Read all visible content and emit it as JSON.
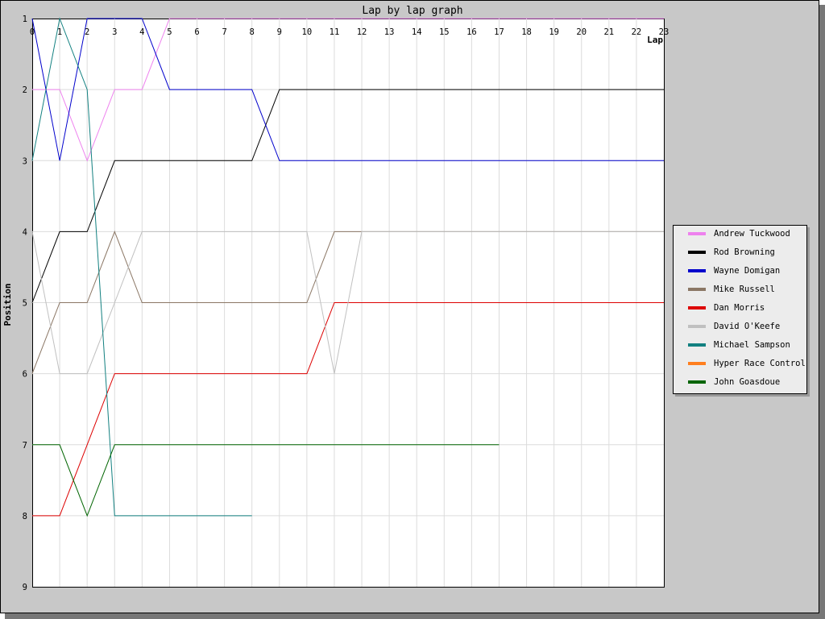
{
  "chart_data": {
    "type": "line",
    "title": "Lap by lap graph",
    "xlabel": "Lap",
    "ylabel": "Position",
    "xlim": [
      0,
      23
    ],
    "ylim": [
      1,
      9
    ],
    "y_inverted": true,
    "grid": true,
    "legend_position": "right",
    "x_ticks": [
      "0",
      "1",
      "2",
      "3",
      "4",
      "5",
      "6",
      "7",
      "8",
      "9",
      "10",
      "11",
      "12",
      "13",
      "14",
      "15",
      "16",
      "17",
      "18",
      "19",
      "20",
      "21",
      "22",
      "23"
    ],
    "y_ticks": [
      "1",
      "2",
      "3",
      "4",
      "5",
      "6",
      "7",
      "8",
      "9"
    ],
    "series": [
      {
        "name": "Andrew Tuckwood",
        "color": "#ee82ee",
        "x": [
          0,
          1,
          2,
          3,
          4,
          5,
          6,
          7,
          8,
          9,
          10,
          11,
          12,
          13,
          14,
          15,
          16,
          17,
          18,
          19,
          20,
          21,
          22,
          23
        ],
        "y": [
          2,
          2,
          3,
          2,
          2,
          1,
          1,
          1,
          1,
          1,
          1,
          1,
          1,
          1,
          1,
          1,
          1,
          1,
          1,
          1,
          1,
          1,
          1,
          1
        ]
      },
      {
        "name": "Rod Browning",
        "color": "#000000",
        "x": [
          0,
          1,
          2,
          3,
          4,
          5,
          6,
          7,
          8,
          9,
          10,
          11,
          12,
          13,
          14,
          15,
          16,
          17,
          18,
          19,
          20,
          21,
          22,
          23
        ],
        "y": [
          5,
          4,
          4,
          3,
          3,
          3,
          3,
          3,
          3,
          2,
          2,
          2,
          2,
          2,
          2,
          2,
          2,
          2,
          2,
          2,
          2,
          2,
          2,
          2
        ]
      },
      {
        "name": "Wayne Domigan",
        "color": "#0000cc",
        "x": [
          0,
          1,
          2,
          3,
          4,
          5,
          6,
          7,
          8,
          9,
          10,
          11,
          12,
          13,
          14,
          15,
          16,
          17,
          18,
          19,
          20,
          21,
          22,
          23
        ],
        "y": [
          1,
          3,
          1,
          1,
          1,
          2,
          2,
          2,
          2,
          3,
          3,
          3,
          3,
          3,
          3,
          3,
          3,
          3,
          3,
          3,
          3,
          3,
          3,
          3
        ]
      },
      {
        "name": "Mike Russell",
        "color": "#8b7765",
        "x": [
          0,
          1,
          2,
          3,
          4,
          5,
          6,
          7,
          8,
          9,
          10,
          11,
          12,
          13,
          14,
          15,
          16,
          17,
          18,
          19,
          20,
          21,
          22,
          23
        ],
        "y": [
          6,
          5,
          5,
          4,
          5,
          5,
          5,
          5,
          5,
          5,
          5,
          4,
          4,
          4,
          4,
          4,
          4,
          4,
          4,
          4,
          4,
          4,
          4,
          4
        ]
      },
      {
        "name": "Dan Morris",
        "color": "#dd0000",
        "x": [
          0,
          1,
          2,
          3,
          4,
          5,
          6,
          7,
          8,
          9,
          10,
          11,
          12,
          13,
          14,
          15,
          16,
          17,
          18,
          19,
          20,
          21,
          22,
          23
        ],
        "y": [
          8,
          8,
          7,
          6,
          6,
          6,
          6,
          6,
          6,
          6,
          6,
          5,
          5,
          5,
          5,
          5,
          5,
          5,
          5,
          5,
          5,
          5,
          5,
          5
        ]
      },
      {
        "name": "David O'Keefe",
        "color": "#c0c0c0",
        "x": [
          0,
          1,
          2,
          3,
          4,
          5,
          6,
          7,
          8,
          9,
          10,
          11,
          12,
          13,
          14,
          15,
          16,
          17,
          18,
          19,
          20,
          21,
          22,
          23
        ],
        "y": [
          4,
          6,
          6,
          5,
          4,
          4,
          4,
          4,
          4,
          4,
          4,
          6,
          4,
          4,
          4,
          4,
          4,
          4,
          4,
          4,
          4,
          4,
          4,
          4
        ]
      },
      {
        "name": "Michael Sampson",
        "color": "#128080",
        "x": [
          0,
          1,
          2,
          3,
          4,
          5,
          6,
          7,
          8
        ],
        "y": [
          3,
          1,
          2,
          8,
          8,
          8,
          8,
          8,
          8
        ]
      },
      {
        "name": "Hyper Race Control",
        "color": "#ff7f1e",
        "x": [],
        "y": []
      },
      {
        "name": "John Goasdoue",
        "color": "#006400",
        "x": [
          0,
          1,
          2,
          3,
          4,
          5,
          6,
          7,
          8,
          9,
          10,
          11,
          12,
          13,
          14,
          15,
          16,
          17
        ],
        "y": [
          7,
          7,
          8,
          7,
          7,
          7,
          7,
          7,
          7,
          7,
          7,
          7,
          7,
          7,
          7,
          7,
          7,
          7
        ]
      }
    ]
  }
}
